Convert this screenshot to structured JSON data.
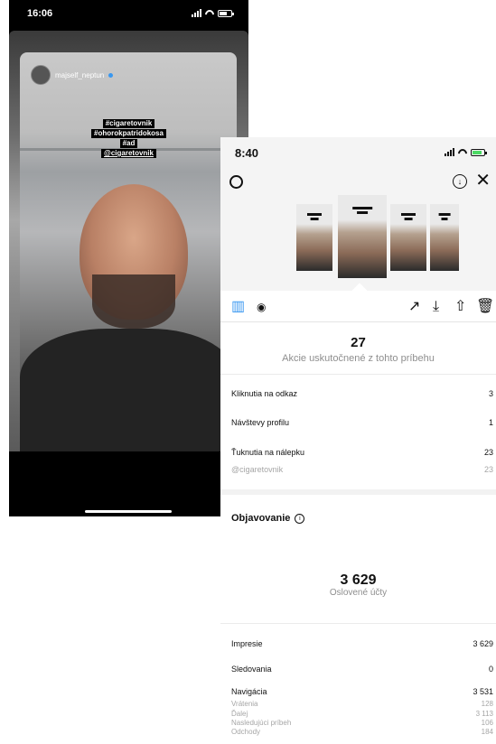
{
  "story_phone": {
    "time": "16:06",
    "username": "majself_neptun",
    "tags": [
      "#cigaretovnik",
      "#ohorokpatridokosa",
      "#ad",
      "@cigaretovnik"
    ]
  },
  "insights_phone": {
    "time": "8:40",
    "icons": {
      "settings": "gear-icon",
      "save": "download-icon",
      "close": "close-icon",
      "insights_tab": "bar-chart-icon",
      "views_tab": "eye-icon",
      "promote": "trend-icon",
      "download": "download-arrow-icon",
      "share": "share-icon",
      "delete": "trash-icon"
    },
    "interactions": {
      "total": "27",
      "caption": "Akcie uskutočnené z tohto príbehu",
      "rows": [
        {
          "label": "Kliknutia na odkaz",
          "value": "3"
        },
        {
          "label": "Návštevy profilu",
          "value": "1"
        },
        {
          "label": "Ťuknutia na nálepku",
          "value": "23"
        },
        {
          "label": "@cigaretovnik",
          "value": "23"
        }
      ]
    },
    "discovery": {
      "title": "Objavovanie",
      "total": "3 629",
      "caption": "Oslovené účty",
      "rows": [
        {
          "label": "Impresie",
          "value": "3 629"
        },
        {
          "label": "Sledovania",
          "value": "0"
        },
        {
          "label": "Navigácia",
          "value": "3 531"
        },
        {
          "label": "Vrátenia",
          "value": "128"
        },
        {
          "label": "Ďalej",
          "value": "3 113"
        },
        {
          "label": "Nasledujúci príbeh",
          "value": "106"
        },
        {
          "label": "Odchody",
          "value": "184"
        }
      ]
    },
    "accent_color": "#3897f0"
  }
}
